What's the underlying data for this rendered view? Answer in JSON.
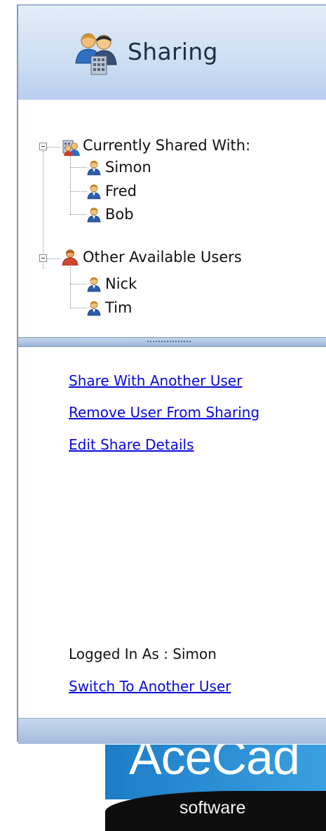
{
  "panel": {
    "title": "Sharing",
    "icons": {
      "header": "sharing-users-icon",
      "shared_group": "shared-group-icon",
      "other_group": "user-group-icon",
      "user": "user-icon",
      "expander": "minus-box-icon"
    }
  },
  "tree": {
    "groups": [
      {
        "label": "Currently Shared With:",
        "expanded": true,
        "users": [
          "Simon",
          "Fred",
          "Bob"
        ]
      },
      {
        "label": "Other Available Users",
        "expanded": true,
        "users": [
          "Nick",
          "Tim"
        ]
      }
    ]
  },
  "actions": {
    "share": "Share With Another User",
    "remove": "Remove User From Sharing",
    "edit": "Edit Share Details"
  },
  "session": {
    "logged_in": "Logged In As : Simon",
    "switch": "Switch To Another User"
  },
  "logo": {
    "word": "AceCad",
    "sub": "software"
  },
  "colors": {
    "link": "#0a0ad9",
    "header_gradient_top": "#e3ecf8",
    "header_gradient_bottom": "#b9cfee"
  }
}
